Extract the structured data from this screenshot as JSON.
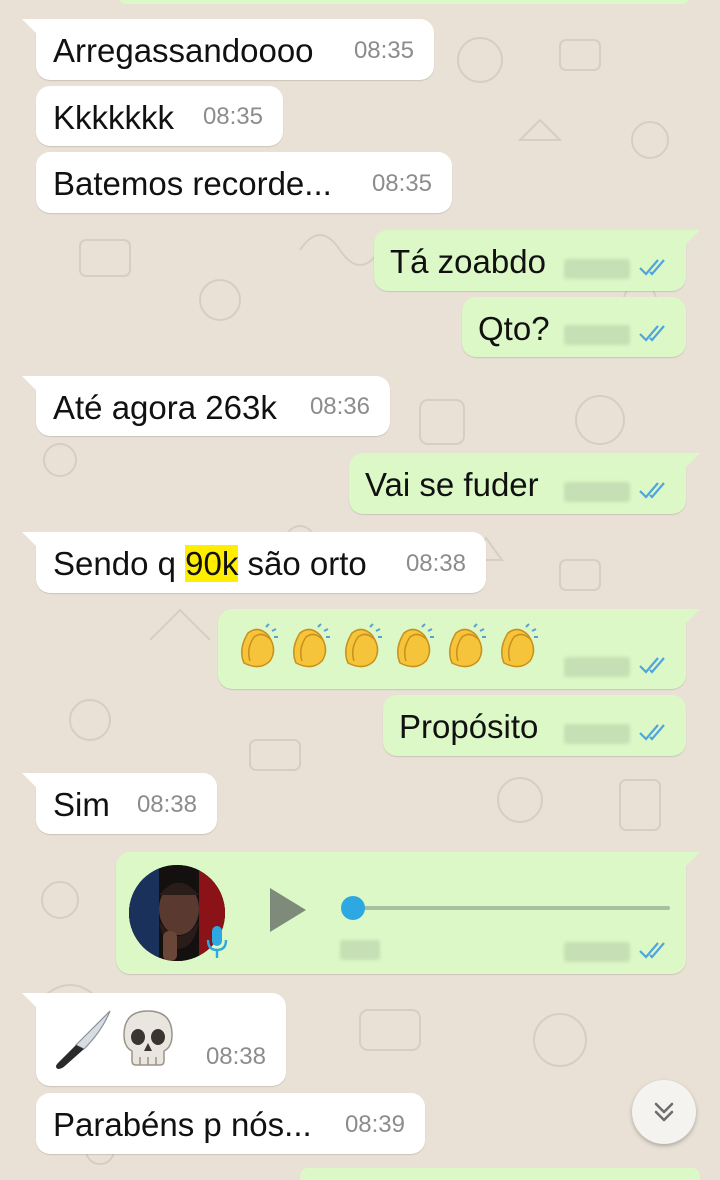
{
  "chat": {
    "messages": [
      {
        "dir": "in",
        "text": "Arregassandoooo",
        "time": "08:35"
      },
      {
        "dir": "in",
        "text": "Kkkkkkk",
        "time": "08:35"
      },
      {
        "dir": "in",
        "text": "Batemos recorde...",
        "time": "08:35"
      },
      {
        "dir": "out",
        "text": "Tá zoabdo",
        "status": "read"
      },
      {
        "dir": "out",
        "text": "Qto?",
        "status": "read"
      },
      {
        "dir": "in",
        "text": "Até agora 263k",
        "time": "08:36"
      },
      {
        "dir": "out",
        "text": "Vai se fuder",
        "status": "read"
      },
      {
        "dir": "in",
        "text_before": "Sendo q ",
        "highlight": "90k",
        "text_after": " são orto",
        "time": "08:38"
      },
      {
        "dir": "out",
        "emoji": "clapping-hands",
        "emoji_count": 6,
        "status": "read"
      },
      {
        "dir": "out",
        "text": "Propósito",
        "status": "read"
      },
      {
        "dir": "in",
        "text": "Sim",
        "time": "08:38"
      },
      {
        "dir": "out",
        "type": "voice",
        "status": "read",
        "progress": 0
      },
      {
        "dir": "in",
        "emoji": [
          "kitchen-knife",
          "skull"
        ],
        "time": "08:38"
      },
      {
        "dir": "in",
        "text": "Parabéns p nós...",
        "time": "08:39"
      }
    ]
  },
  "colors": {
    "background": "#e9e1d6",
    "incoming": "#ffffff",
    "outgoing": "#dcf8c6",
    "read_ticks": "#4fa5dc",
    "highlight": "#ffee00",
    "voice_accent": "#2ea8e0"
  },
  "icons": {
    "read_receipt": "double-check-icon",
    "play": "play-icon",
    "mic": "mic-icon",
    "scroll": "double-chevron-down-icon"
  }
}
